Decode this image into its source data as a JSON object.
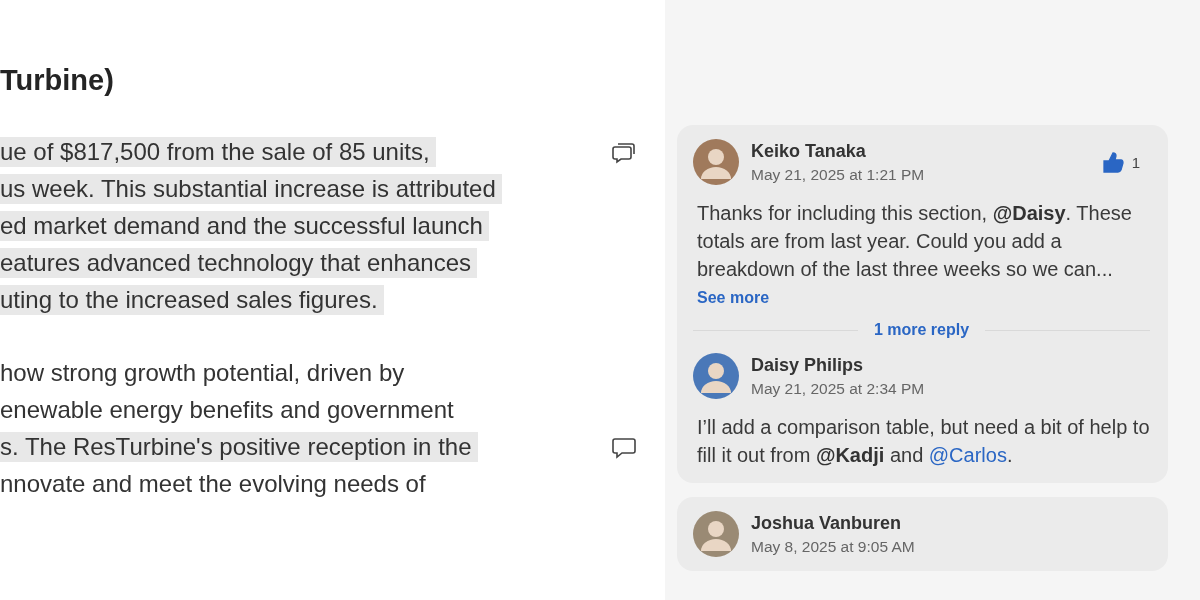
{
  "document": {
    "heading": "Turbine)",
    "paragraphs": [
      {
        "kind": "thread",
        "lines": [
          {
            "text": "ue of $817,500 from the sale of 85 units,",
            "highlighted": true
          },
          {
            "text": "us week. This substantial increase is attributed",
            "highlighted": true
          },
          {
            "text": "ed market demand and the successful launch",
            "highlighted": true
          },
          {
            "text": "eatures advanced technology that enhances",
            "highlighted": true
          },
          {
            "text": "uting to the increased sales figures.",
            "highlighted": true
          }
        ]
      },
      {
        "kind": "single",
        "lines": [
          {
            "text": "how strong growth potential, driven by",
            "highlighted": false
          },
          {
            "text": "enewable energy benefits and government",
            "highlighted": false
          },
          {
            "text": "s. The ResTurbine's positive reception in the",
            "highlighted": true
          },
          {
            "text": "nnovate and meet the evolving needs of",
            "highlighted": false
          }
        ]
      }
    ]
  },
  "comments": {
    "threads": [
      {
        "comments": [
          {
            "author": "Keiko Tanaka",
            "time": "May 21, 2025 at 1:21 PM",
            "color": "#a07a5c",
            "likes": "1",
            "liked": true,
            "body": [
              {
                "kind": "plain",
                "text": "Thanks for including this section, "
              },
              {
                "kind": "mention",
                "text": "@Daisy"
              },
              {
                "kind": "plain",
                "text": ". These totals are from last year. Could you add a breakdown of the last three weeks so we can..."
              }
            ],
            "see_more": "See more"
          },
          {
            "author": "Daisy Philips",
            "time": "May 21, 2025 at 2:34 PM",
            "color": "#4a78b8",
            "body": [
              {
                "kind": "plain",
                "text": "I’ll add a comparison table, but need a bit of help to fill it out from "
              },
              {
                "kind": "mention",
                "text": "@Kadji"
              },
              {
                "kind": "plain",
                "text": " and "
              },
              {
                "kind": "link",
                "text": "@Carlos"
              },
              {
                "kind": "plain",
                "text": "."
              }
            ]
          }
        ],
        "more_replies": "1 more reply"
      },
      {
        "comments": [
          {
            "author": "Joshua Vanburen",
            "time": "May 8, 2025 at 9:05 AM",
            "color": "#9a8a74"
          }
        ]
      }
    ]
  }
}
